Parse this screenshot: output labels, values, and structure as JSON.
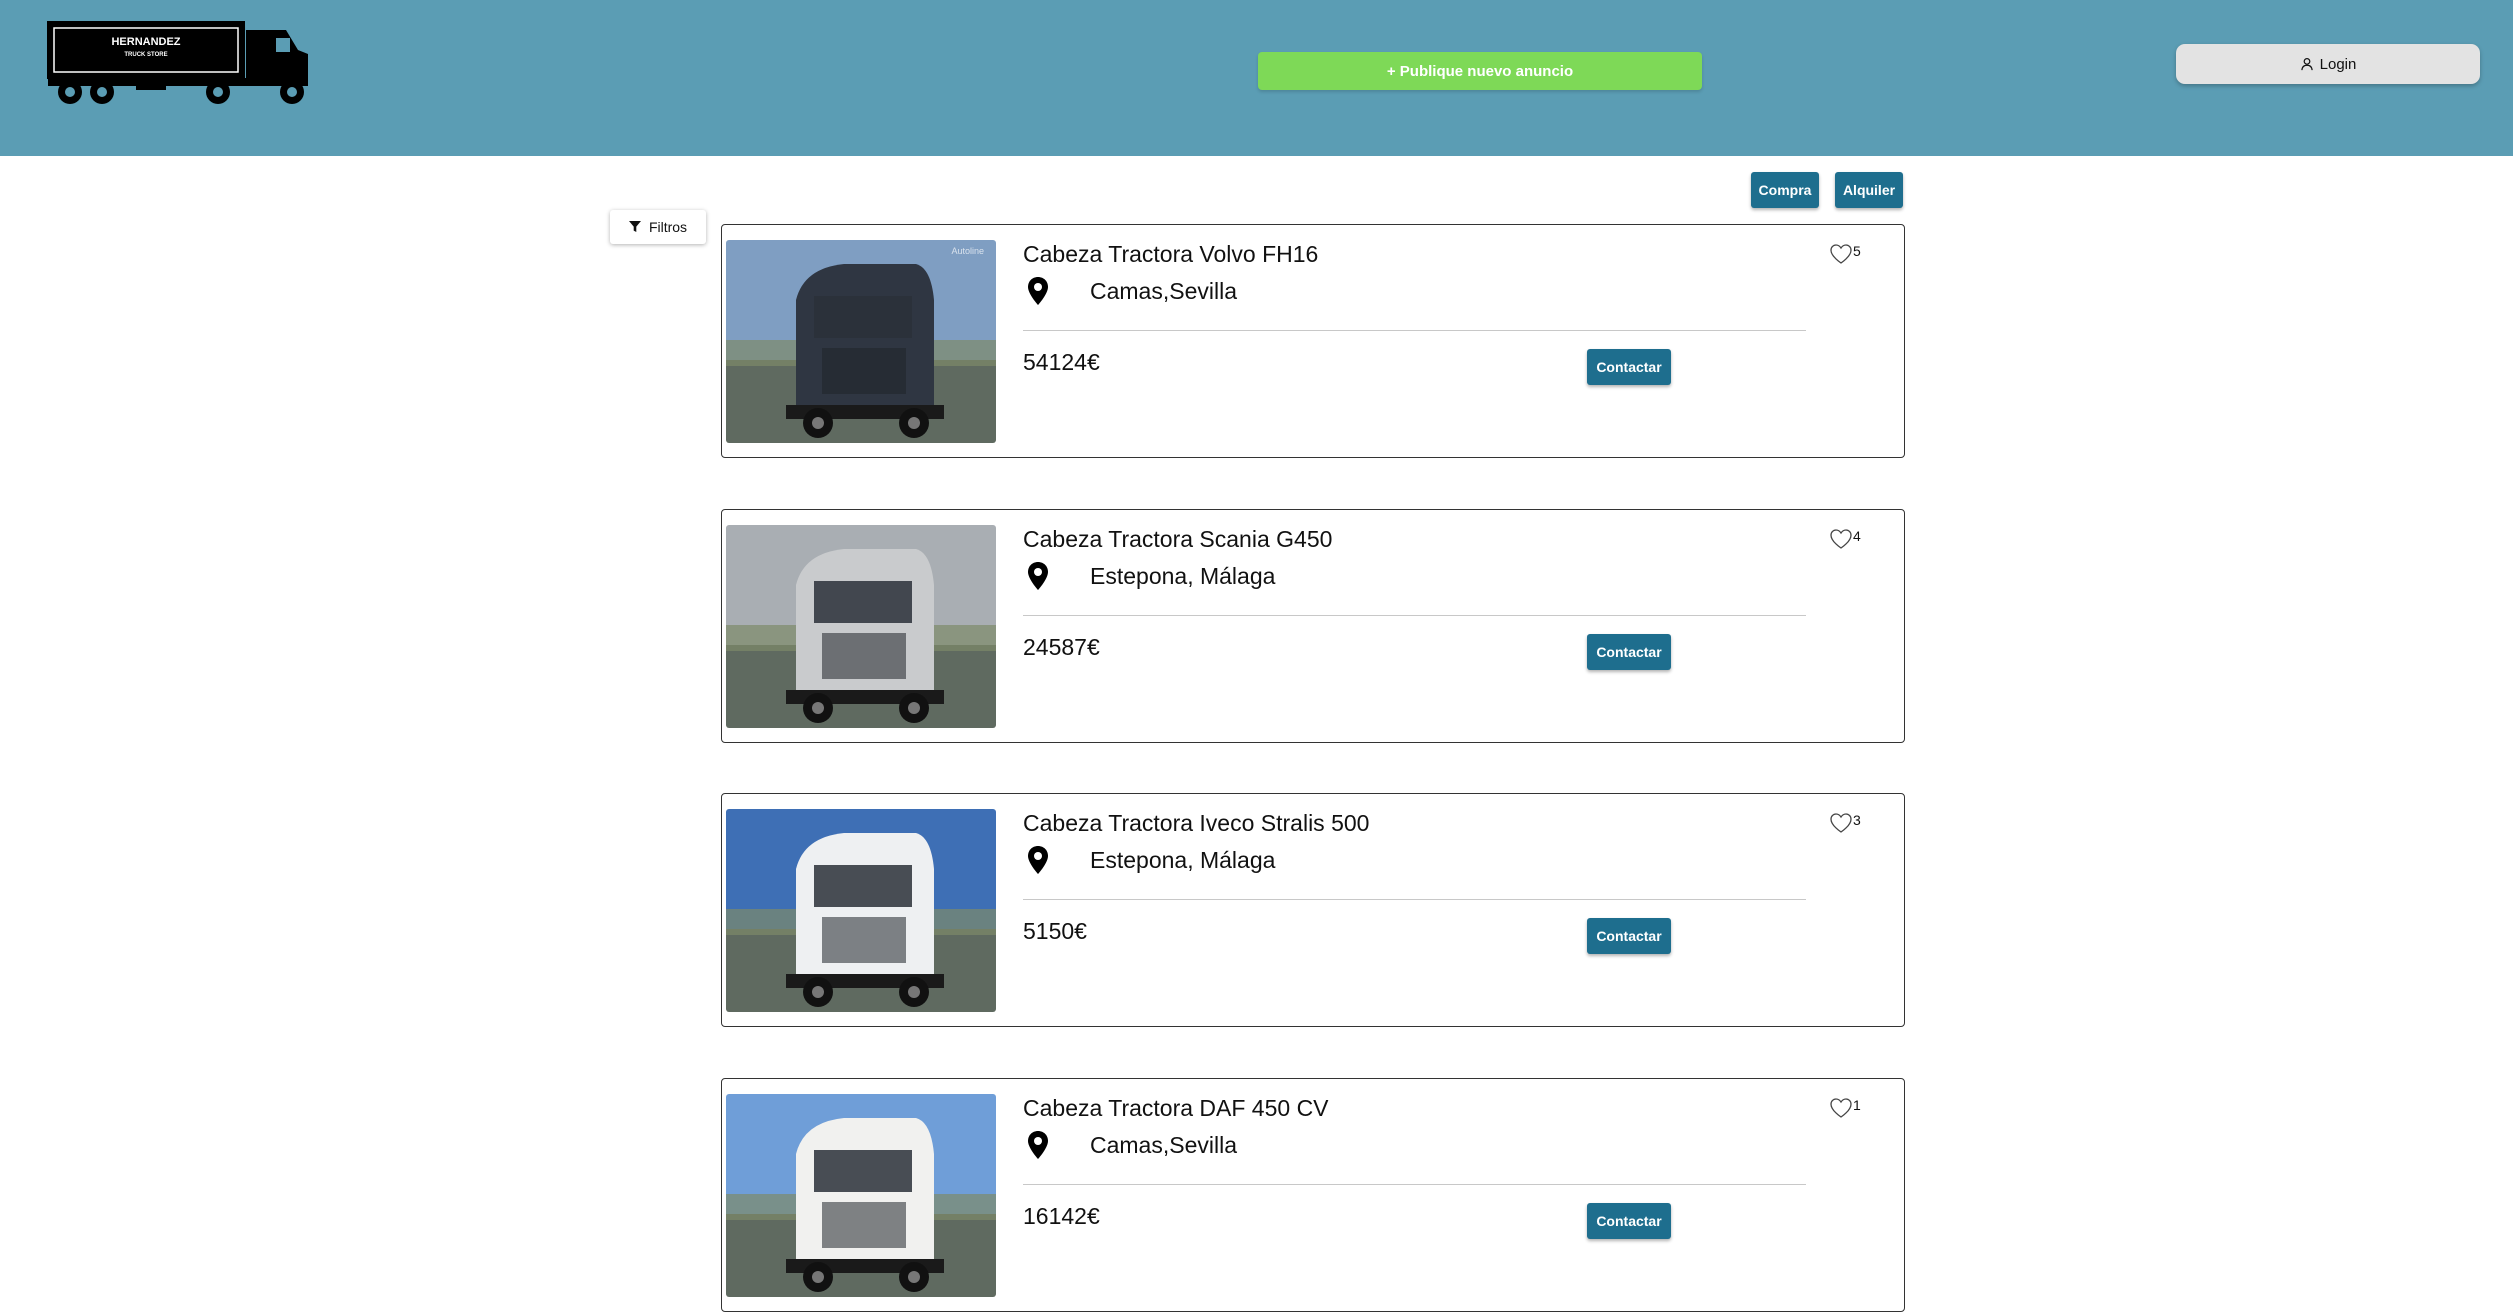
{
  "header": {
    "logo_title": "HERNANDEZ",
    "logo_subtitle": "TRUCK STORE",
    "publish_label": "+ Publique nuevo anuncio",
    "login_label": "Login"
  },
  "tabs": {
    "buy_label": "Compra",
    "rent_label": "Alquiler"
  },
  "filters_label": "Filtros",
  "listings": [
    {
      "title": "Cabeza Tractora Volvo FH16",
      "location": "Camas,Sevilla",
      "price": "54124€",
      "favorites": "5",
      "contact_label": "Contactar",
      "image_watermark": "Autoline",
      "sky_color": "#7f9ec2",
      "body_color": "#2f3642"
    },
    {
      "title": "Cabeza Tractora Scania G450",
      "location": "Estepona, Málaga",
      "price": "24587€",
      "favorites": "4",
      "contact_label": "Contactar",
      "sky_color": "#a9aeb3",
      "body_color": "#c9cbcd"
    },
    {
      "title": "Cabeza Tractora Iveco Stralis 500",
      "location": "Estepona, Málaga",
      "price": "5150€",
      "favorites": "3",
      "contact_label": "Contactar",
      "sky_color": "#3e6fb5",
      "body_color": "#eef0f2"
    },
    {
      "title": "Cabeza Tractora DAF 450 CV",
      "location": "Camas,Sevilla",
      "price": "16142€",
      "favorites": "1",
      "contact_label": "Contactar",
      "sky_color": "#6f9ed8",
      "body_color": "#f1f1ef"
    }
  ]
}
